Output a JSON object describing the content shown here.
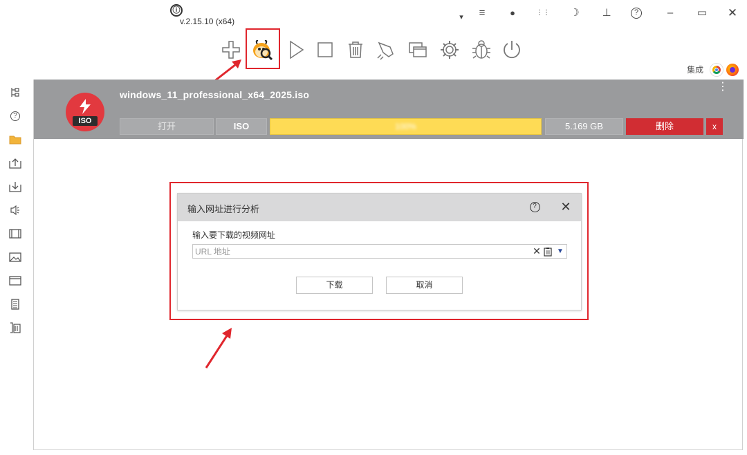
{
  "app": {
    "logo_glyph": "ⓘ",
    "version": "v.2.15.10 (x64)"
  },
  "window_controls": [
    {
      "name": "collapse-icon",
      "glyph": "▾"
    },
    {
      "name": "menu-icon",
      "glyph": "≡"
    },
    {
      "name": "record-icon",
      "glyph": "●"
    },
    {
      "name": "equalizer-icon",
      "glyph": "⋮⋮"
    },
    {
      "name": "night-mode-icon",
      "glyph": "☽"
    },
    {
      "name": "pin-icon",
      "glyph": "⊥"
    },
    {
      "name": "help-icon",
      "glyph": "?"
    },
    {
      "name": "minimize-icon",
      "glyph": "–"
    },
    {
      "name": "maximize-icon",
      "glyph": "▭"
    },
    {
      "name": "close-icon",
      "glyph": "✕"
    }
  ],
  "toolbar": {
    "icons": [
      "add-icon",
      "grabber-bug-icon",
      "play-icon",
      "stop-icon",
      "trash-icon",
      "rocket-icon",
      "windows-icon",
      "settings-gear-icon",
      "bug-icon",
      "power-icon"
    ]
  },
  "integration": {
    "label": "集成"
  },
  "sidebar": {
    "icons": [
      "tree-icon",
      "help-circle-icon",
      "folder-icon",
      "upload-icon",
      "download-icon",
      "audio-icon",
      "video-icon",
      "image-icon",
      "window-icon",
      "document-icon",
      "archive-icon"
    ]
  },
  "task": {
    "filename": "windows_11_professional_x64_2025.iso",
    "badge": "ISO",
    "open_label": "打开",
    "type_label": "ISO",
    "progress_text": "100%",
    "progress": 1.0,
    "size": "5.169 GB",
    "delete_label": "删除",
    "remove_label": "x",
    "more_glyph": "⋮"
  },
  "dialog": {
    "title": "输入网址进行分析",
    "help_glyph": "?",
    "close_glyph": "✕",
    "field_label": "输入要下载的视频网址",
    "url_placeholder": "URL 地址",
    "url_value": "",
    "clear_glyph": "✕",
    "dropdown_glyph": "▼",
    "download_label": "下载",
    "cancel_label": "取消"
  },
  "colors": {
    "task_row_bg": "#9a9b9d",
    "progress_fill": "#fedb55",
    "delete_red": "#d12d33",
    "highlight_red": "#e0262d",
    "iso_badge_red": "#e2393f"
  }
}
